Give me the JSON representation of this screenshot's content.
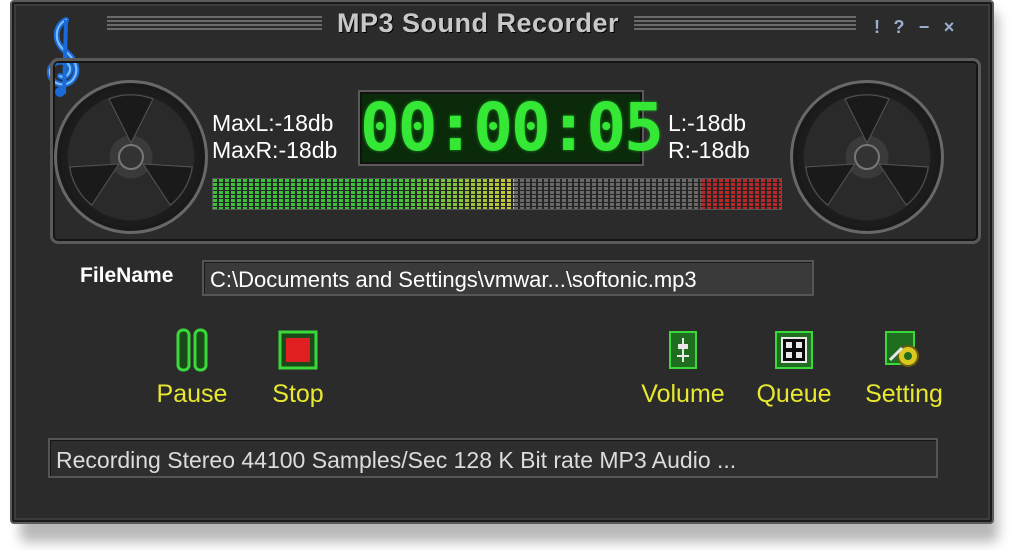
{
  "window": {
    "title": "MP3 Sound Recorder",
    "buttons": {
      "help": "!",
      "about": "?",
      "minimize": "−",
      "close": "×"
    }
  },
  "levels": {
    "max_left": "MaxL:-18db",
    "max_right": "MaxR:-18db",
    "left": "L:-18db",
    "right": "R:-18db",
    "meter_fill_fraction": 0.53
  },
  "timer": "00:00:05",
  "file": {
    "label": "FileName",
    "value": "C:\\Documents and Settings\\vmwar...\\softonic.mp3"
  },
  "controls": {
    "pause": "Pause",
    "stop": "Stop",
    "volume": "Volume",
    "queue": "Queue",
    "setting": "Setting"
  },
  "status": "Recording Stereo 44100 Samples/Sec 128 K Bit rate MP3 Audio ...",
  "colors": {
    "accent_label": "#e8e830",
    "timer_digits": "#35e835",
    "meter_green": "#3ac23a",
    "meter_yellow": "#c8c83a",
    "meter_red": "#b82828",
    "stop_red": "#e02020",
    "icon_green": "#2ecc2e"
  },
  "icons": {
    "clef": "treble-clef-icon",
    "pause": "pause-icon",
    "stop": "stop-icon",
    "volume": "volume-icon",
    "queue": "queue-icon",
    "setting": "setting-icon"
  }
}
